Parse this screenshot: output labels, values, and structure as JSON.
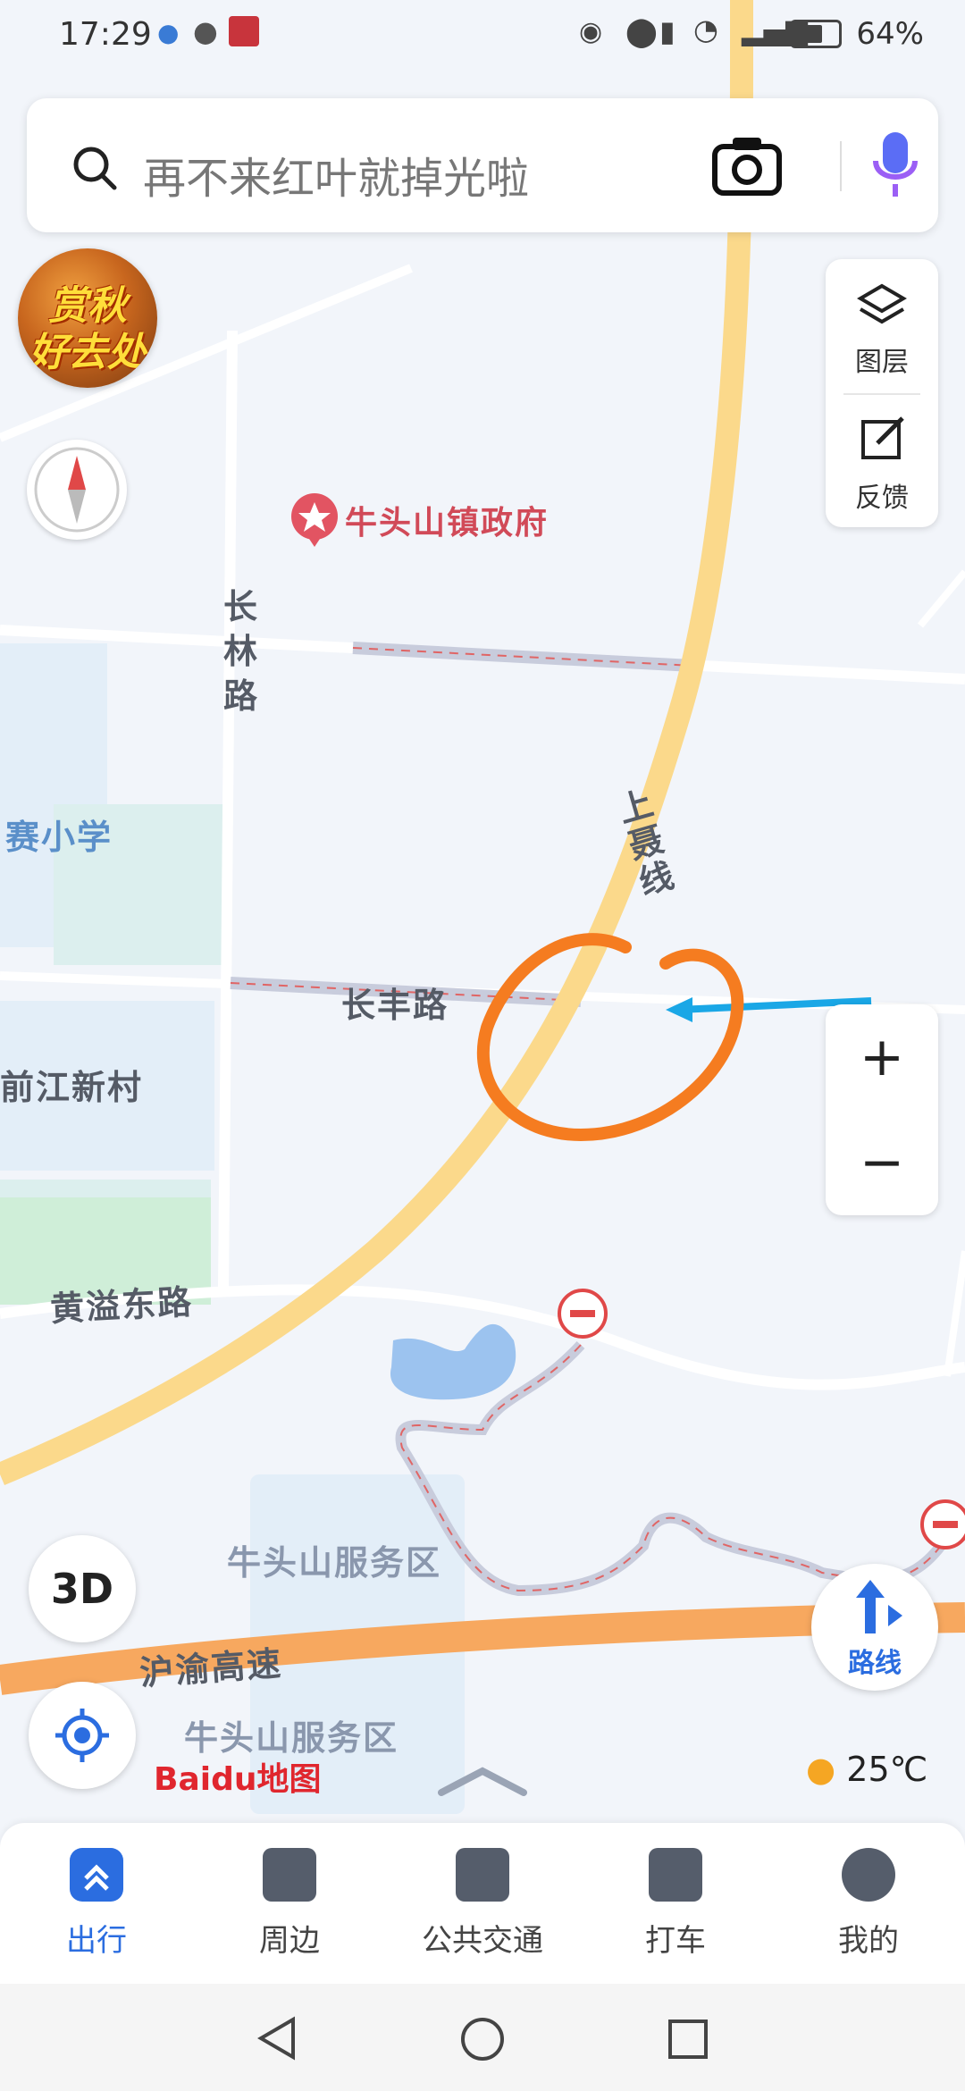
{
  "status_bar": {
    "time": "17:29",
    "battery": "64%"
  },
  "search": {
    "placeholder": "再不来红叶就掉光啦"
  },
  "badge": {
    "line1": "赏秋",
    "line2": "好去处"
  },
  "side_panel": {
    "layers_label": "图层",
    "feedback_label": "反馈"
  },
  "map": {
    "poi": "牛头山镇政府",
    "roads": {
      "changlin": "长林路",
      "shangnie": "上聂线",
      "changfeng": "长丰路",
      "huangyi": "黄溢东路",
      "hu_yu": "沪渝高速"
    },
    "places": {
      "school": "赛小学",
      "village": "前江新村",
      "service_area_1": "牛头山服务区",
      "service_area_2": "牛头山服务区"
    }
  },
  "buttons": {
    "three_d": "3D",
    "route": "路线",
    "zoom_in": "+",
    "zoom_out": "−"
  },
  "weather": {
    "temp": "25℃"
  },
  "logo": {
    "text": "Baidu地图"
  },
  "bottom_nav": {
    "items": [
      {
        "label": "出行"
      },
      {
        "label": "周边"
      },
      {
        "label": "公共交通"
      },
      {
        "label": "打车"
      },
      {
        "label": "我的"
      }
    ]
  },
  "colors": {
    "accent": "#2b6de0",
    "highway": "#f7a85f",
    "road_main": "#fbd98b",
    "annotation": "#f57c20"
  }
}
